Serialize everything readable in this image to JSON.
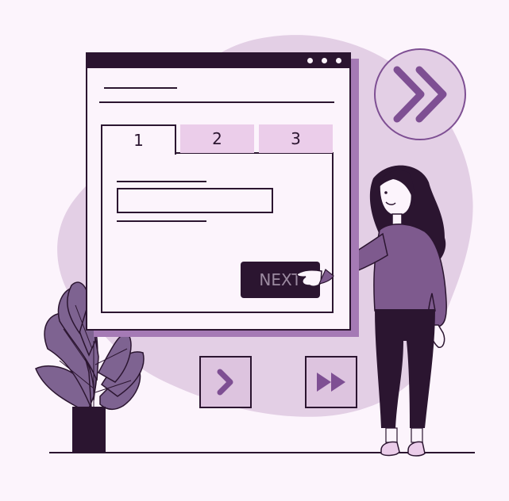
{
  "tabs": [
    {
      "label": "1",
      "active": true
    },
    {
      "label": "2",
      "active": false
    },
    {
      "label": "3",
      "active": false
    }
  ],
  "next_button": {
    "label": "NEXT"
  },
  "colors": {
    "background": "#FCF4FC",
    "blob": "#E8D4E8",
    "dark": "#2B1530",
    "accent": "#A57AB5",
    "accent_dark": "#7E4F93",
    "tab_inactive": "#EBCDEA",
    "plant": "#7E6391"
  },
  "icons": {
    "forward_circle": "double-chevron-right-icon",
    "next_square": "chevron-right-icon",
    "fast_forward_square": "fast-forward-icon"
  }
}
